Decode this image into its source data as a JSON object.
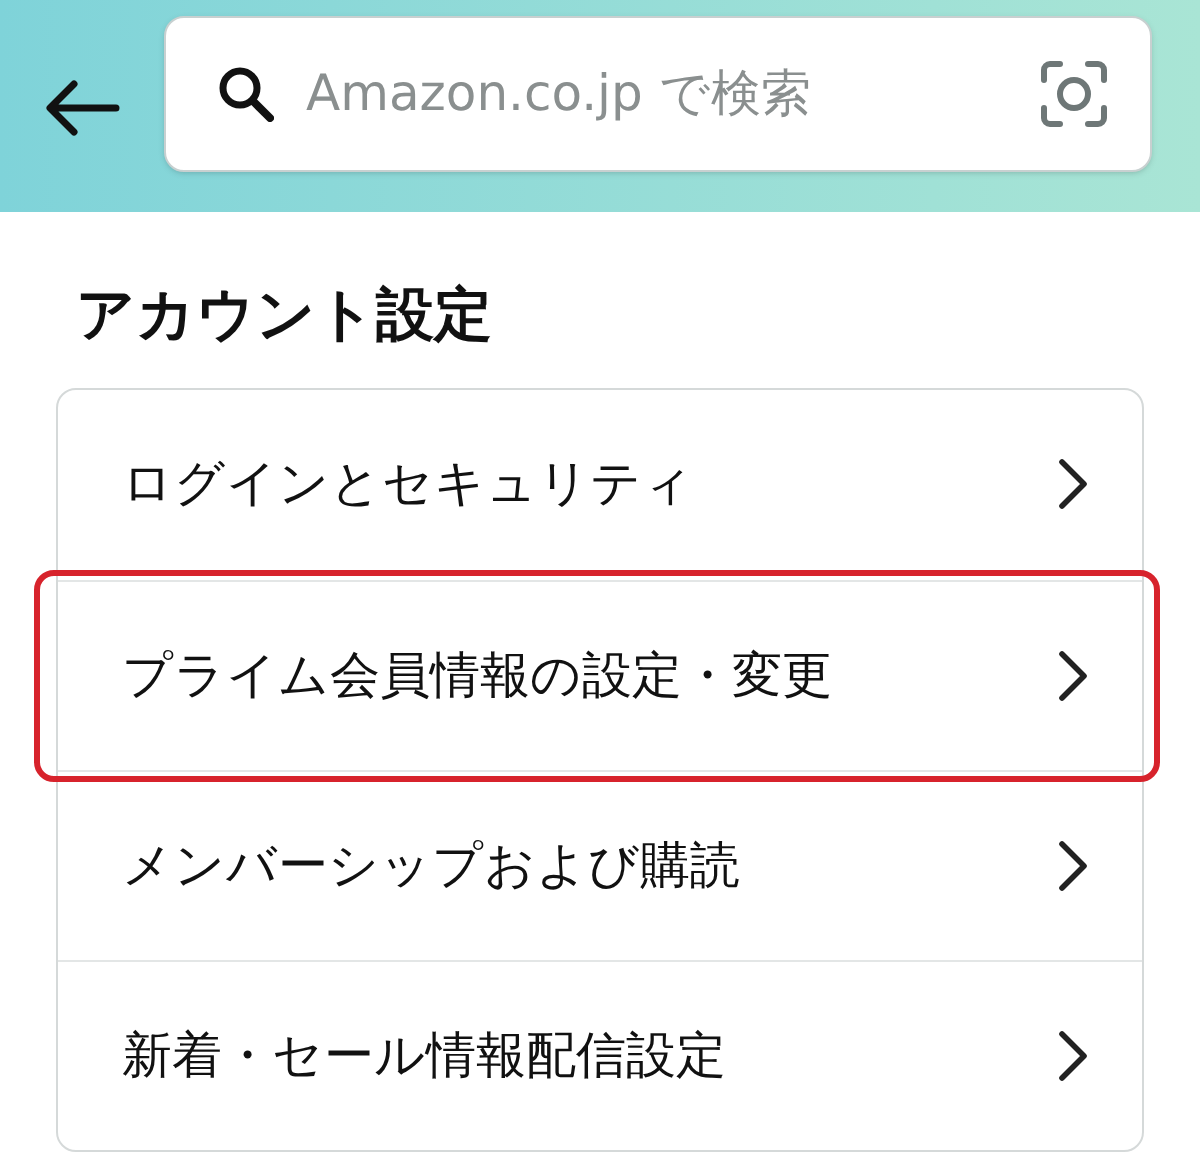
{
  "search": {
    "placeholder": "Amazon.co.jp で検索"
  },
  "section_title": "アカウント設定",
  "rows": [
    {
      "label": "ログインとセキュリティ",
      "highlighted": false
    },
    {
      "label": "プライム会員情報の設定・変更",
      "highlighted": true
    },
    {
      "label": "メンバーシップおよび購読",
      "highlighted": false
    },
    {
      "label": "新着・セール情報配信設定",
      "highlighted": false
    }
  ]
}
